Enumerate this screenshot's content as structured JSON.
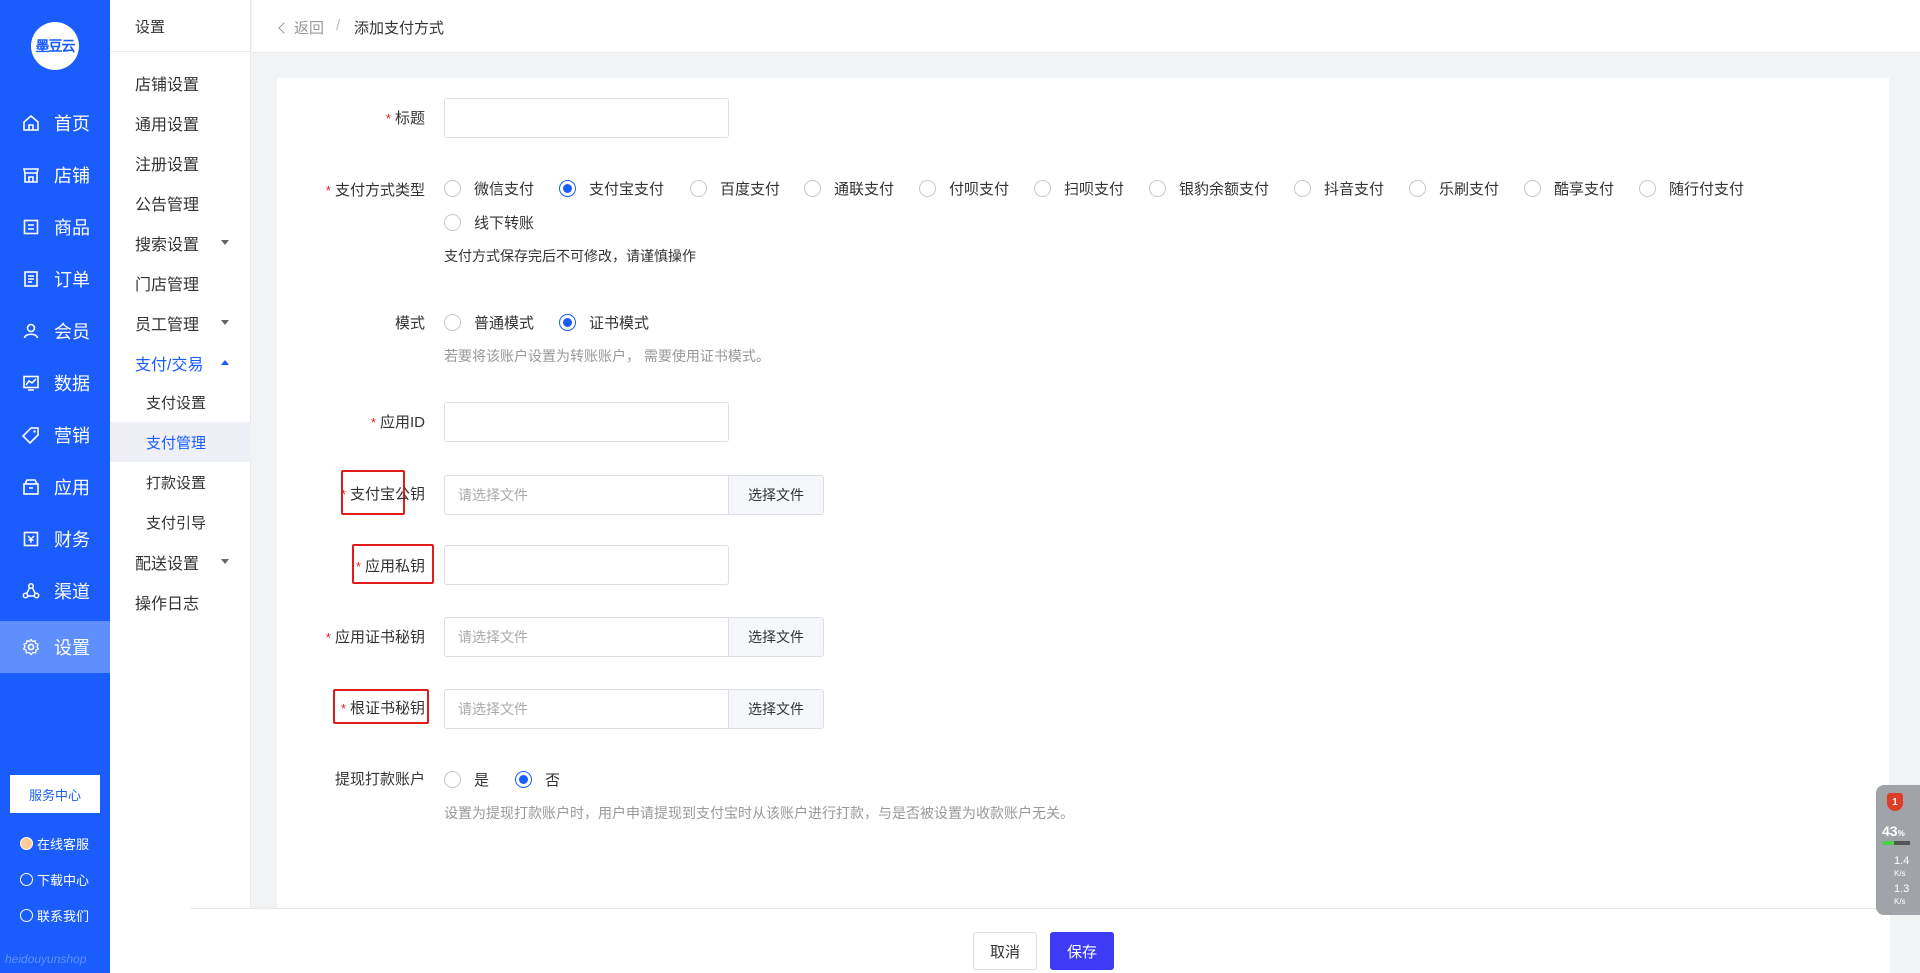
{
  "brand": {
    "logo_text": "墨豆云",
    "watermark": "heidouyunshop",
    "primary": "#1a5dfc"
  },
  "main_nav": [
    {
      "label": "首页",
      "icon": "home-icon"
    },
    {
      "label": "店铺",
      "icon": "store-icon"
    },
    {
      "label": "商品",
      "icon": "goods-icon"
    },
    {
      "label": "订单",
      "icon": "order-icon"
    },
    {
      "label": "会员",
      "icon": "member-icon"
    },
    {
      "label": "数据",
      "icon": "chart-icon"
    },
    {
      "label": "营销",
      "icon": "tag-icon"
    },
    {
      "label": "应用",
      "icon": "app-icon"
    },
    {
      "label": "财务",
      "icon": "finance-icon"
    },
    {
      "label": "渠道",
      "icon": "channel-icon"
    },
    {
      "label": "设置",
      "icon": "gear-icon"
    }
  ],
  "service": {
    "center": "服务中心",
    "online": "在线客服",
    "download": "下载中心",
    "contact": "联系我们"
  },
  "sub_nav": {
    "title": "设置",
    "items": [
      "店铺设置",
      "通用设置",
      "注册设置",
      "公告管理",
      "搜索设置",
      "门店管理",
      "员工管理",
      "支付/交易",
      "支付设置",
      "支付管理",
      "打款设置",
      "支付引导",
      "配送设置",
      "操作日志"
    ]
  },
  "header": {
    "back": "返回",
    "sep": "/",
    "current": "添加支付方式"
  },
  "form": {
    "title_label": "标题",
    "pay_type_label": "支付方式类型",
    "pay_types": [
      "微信支付",
      "支付宝支付",
      "百度支付",
      "通联支付",
      "付呗支付",
      "扫呗支付",
      "银豹余额支付",
      "抖音支付",
      "乐刷支付",
      "酷享支付",
      "随行付支付",
      "线下转账"
    ],
    "pay_type_selected": "支付宝支付",
    "pay_type_note": "支付方式保存完后不可修改，请谨慎操作",
    "mode_label": "模式",
    "modes": [
      "普通模式",
      "证书模式"
    ],
    "mode_selected": "证书模式",
    "mode_hint": "若要将该账户设置为转账账户， 需要使用证书模式。",
    "app_id_label": "应用ID",
    "alipay_pubkey_label": "支付宝公钥",
    "app_privkey_label": "应用私钥",
    "app_cert_label": "应用证书秘钥",
    "root_cert_label": "根证书秘钥",
    "file_placeholder": "请选择文件",
    "file_button": "选择文件",
    "withdraw_label": "提现打款账户",
    "withdraw_options": [
      "是",
      "否"
    ],
    "withdraw_selected": "否",
    "withdraw_hint": "设置为提现打款账户时，用户申请提现到支付宝时从该账户进行打款，与是否被设置为收款账户无关。",
    "required_mark": "*"
  },
  "actions": {
    "cancel": "取消",
    "save": "保存"
  },
  "widget": {
    "badge": "1",
    "cpu": "43",
    "cpu_unit": "%",
    "up": "1.4",
    "down": "1.3",
    "unit": "K/s"
  }
}
